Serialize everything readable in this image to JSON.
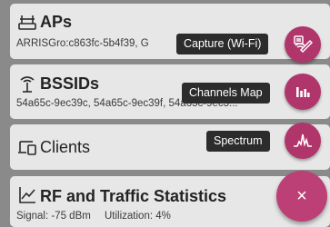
{
  "cards": {
    "aps": {
      "title": "APs",
      "subtitle": "ARRISGro:c863fc-5b4f39, G",
      "icon": "router-icon"
    },
    "bssids": {
      "title": "BSSIDs",
      "subtitle": "54a65c-9ec39c, 54a65c-9ec39f, 54a65c-9ec3...",
      "icon": "antenna-icon"
    },
    "clients": {
      "title": "Clients",
      "icon": "devices-icon"
    },
    "rf": {
      "title": "RF and Traffic Statistics",
      "signal": "Signal: -75 dBm",
      "utilization": "Utilization: 4%",
      "icon": "line-chart-icon"
    }
  },
  "speed_dial": {
    "capture": {
      "label": "Capture (Wi-Fi)",
      "icon": "capture-wifi-icon"
    },
    "channels_map": {
      "label": "Channels Map",
      "icon": "bar-chart-icon"
    },
    "spectrum": {
      "label": "Spectrum",
      "icon": "spectrum-icon"
    },
    "close": {
      "label": "×",
      "icon": "close-icon"
    }
  },
  "colors": {
    "scrim": "#8a8a8a",
    "card": "#e7e7e7",
    "accent": "#b0356b",
    "tooltip": "#2c2c2c"
  }
}
